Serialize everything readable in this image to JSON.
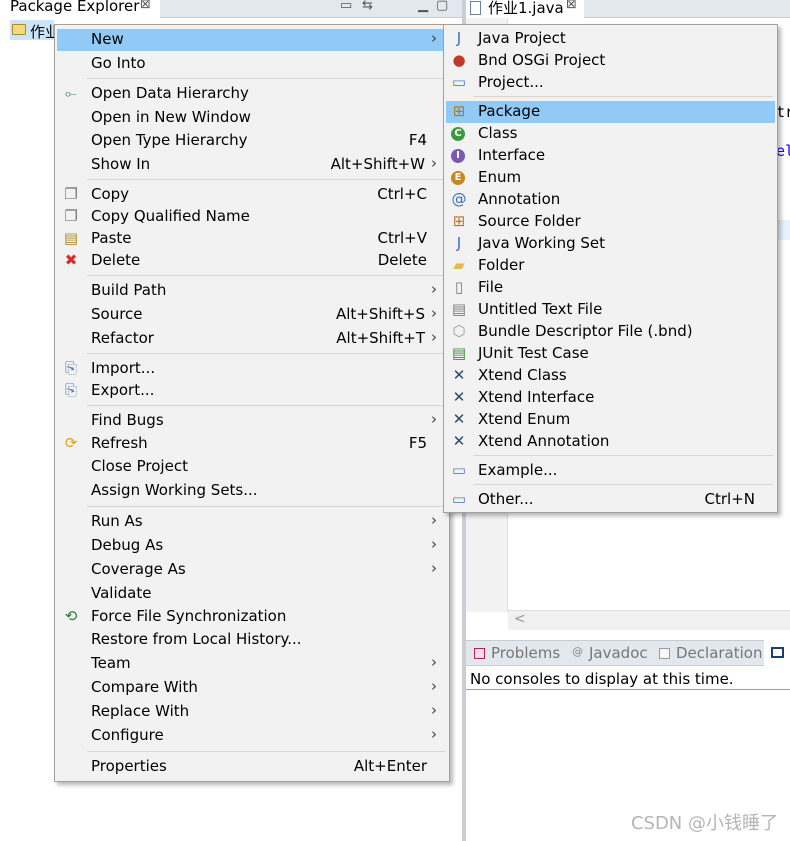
{
  "package_explorer": {
    "title": "Package Explorer",
    "close_glyph": "⊠",
    "tree_item": "作业"
  },
  "editor": {
    "tab_title": "作业1.java",
    "close_glyph": "⊠",
    "code_fragments": [
      "tr",
      "el"
    ],
    "scroll_left_glyph": "<"
  },
  "console": {
    "tabs": [
      {
        "label": "Problems",
        "icon": "problems-icon"
      },
      {
        "label": "Javadoc",
        "icon": "javadoc-icon"
      },
      {
        "label": "Declaration",
        "icon": "declaration-icon"
      }
    ],
    "message": "No consoles to display at this time."
  },
  "context_menu": {
    "items": [
      {
        "label": "New",
        "accel": "",
        "submenu": true,
        "icon": "",
        "highlighted": true
      },
      {
        "label": "Go Into",
        "accel": "",
        "submenu": false,
        "icon": ""
      },
      {
        "label": "Open Data Hierarchy",
        "accel": "",
        "submenu": false,
        "icon": "data-hierarchy-icon"
      },
      {
        "label": "Open in New Window",
        "accel": "",
        "submenu": false,
        "icon": ""
      },
      {
        "label": "Open Type Hierarchy",
        "accel": "F4",
        "submenu": false,
        "icon": ""
      },
      {
        "label": "Show In",
        "accel": "Alt+Shift+W",
        "submenu": true,
        "icon": ""
      },
      {
        "label": "Copy",
        "accel": "Ctrl+C",
        "submenu": false,
        "icon": "copy-icon"
      },
      {
        "label": "Copy Qualified Name",
        "accel": "",
        "submenu": false,
        "icon": "copy-qualified-name-icon"
      },
      {
        "label": "Paste",
        "accel": "Ctrl+V",
        "submenu": false,
        "icon": "paste-icon"
      },
      {
        "label": "Delete",
        "accel": "Delete",
        "submenu": false,
        "icon": "delete-icon"
      },
      {
        "label": "Build Path",
        "accel": "",
        "submenu": true,
        "icon": ""
      },
      {
        "label": "Source",
        "accel": "Alt+Shift+S",
        "submenu": true,
        "icon": ""
      },
      {
        "label": "Refactor",
        "accel": "Alt+Shift+T",
        "submenu": true,
        "icon": ""
      },
      {
        "label": "Import...",
        "accel": "",
        "submenu": false,
        "icon": "import-icon"
      },
      {
        "label": "Export...",
        "accel": "",
        "submenu": false,
        "icon": "export-icon"
      },
      {
        "label": "Find Bugs",
        "accel": "",
        "submenu": true,
        "icon": ""
      },
      {
        "label": "Refresh",
        "accel": "F5",
        "submenu": false,
        "icon": "refresh-icon"
      },
      {
        "label": "Close Project",
        "accel": "",
        "submenu": false,
        "icon": ""
      },
      {
        "label": "Assign Working Sets...",
        "accel": "",
        "submenu": false,
        "icon": ""
      },
      {
        "label": "Run As",
        "accel": "",
        "submenu": true,
        "icon": ""
      },
      {
        "label": "Debug As",
        "accel": "",
        "submenu": true,
        "icon": ""
      },
      {
        "label": "Coverage As",
        "accel": "",
        "submenu": true,
        "icon": ""
      },
      {
        "label": "Validate",
        "accel": "",
        "submenu": false,
        "icon": ""
      },
      {
        "label": "Force File Synchronization",
        "accel": "",
        "submenu": false,
        "icon": "sync-icon"
      },
      {
        "label": "Restore from Local History...",
        "accel": "",
        "submenu": false,
        "icon": ""
      },
      {
        "label": "Team",
        "accel": "",
        "submenu": true,
        "icon": ""
      },
      {
        "label": "Compare With",
        "accel": "",
        "submenu": true,
        "icon": ""
      },
      {
        "label": "Replace With",
        "accel": "",
        "submenu": true,
        "icon": ""
      },
      {
        "label": "Configure",
        "accel": "",
        "submenu": true,
        "icon": ""
      },
      {
        "label": "Properties",
        "accel": "Alt+Enter",
        "submenu": false,
        "icon": ""
      }
    ]
  },
  "new_submenu": {
    "items": [
      {
        "label": "Java Project",
        "accel": "",
        "icon": "java-project-icon"
      },
      {
        "label": "Bnd OSGi Project",
        "accel": "",
        "icon": "bnd-osgi-project-icon"
      },
      {
        "label": "Project...",
        "accel": "",
        "icon": "project-icon"
      },
      {
        "label": "Package",
        "accel": "",
        "icon": "package-icon",
        "highlighted": true
      },
      {
        "label": "Class",
        "accel": "",
        "icon": "class-icon"
      },
      {
        "label": "Interface",
        "accel": "",
        "icon": "interface-icon"
      },
      {
        "label": "Enum",
        "accel": "",
        "icon": "enum-icon"
      },
      {
        "label": "Annotation",
        "accel": "",
        "icon": "annotation-icon"
      },
      {
        "label": "Source Folder",
        "accel": "",
        "icon": "source-folder-icon"
      },
      {
        "label": "Java Working Set",
        "accel": "",
        "icon": "java-working-set-icon"
      },
      {
        "label": "Folder",
        "accel": "",
        "icon": "folder-icon"
      },
      {
        "label": "File",
        "accel": "",
        "icon": "file-icon"
      },
      {
        "label": "Untitled Text File",
        "accel": "",
        "icon": "untitled-text-file-icon"
      },
      {
        "label": "Bundle Descriptor File (.bnd)",
        "accel": "",
        "icon": "bundle-descriptor-icon"
      },
      {
        "label": "JUnit Test Case",
        "accel": "",
        "icon": "junit-test-case-icon"
      },
      {
        "label": "Xtend Class",
        "accel": "",
        "icon": "xtend-class-icon"
      },
      {
        "label": "Xtend Interface",
        "accel": "",
        "icon": "xtend-interface-icon"
      },
      {
        "label": "Xtend Enum",
        "accel": "",
        "icon": "xtend-enum-icon"
      },
      {
        "label": "Xtend Annotation",
        "accel": "",
        "icon": "xtend-annotation-icon"
      },
      {
        "label": "Example...",
        "accel": "",
        "icon": "example-icon"
      },
      {
        "label": "Other...",
        "accel": "Ctrl+N",
        "icon": "other-icon"
      }
    ]
  },
  "watermark": "CSDN @小钱睡了",
  "colors": {
    "menu_background": "#f2f2f2",
    "menu_highlight": "#91c9f7",
    "tree_selection": "#cce4f7"
  }
}
